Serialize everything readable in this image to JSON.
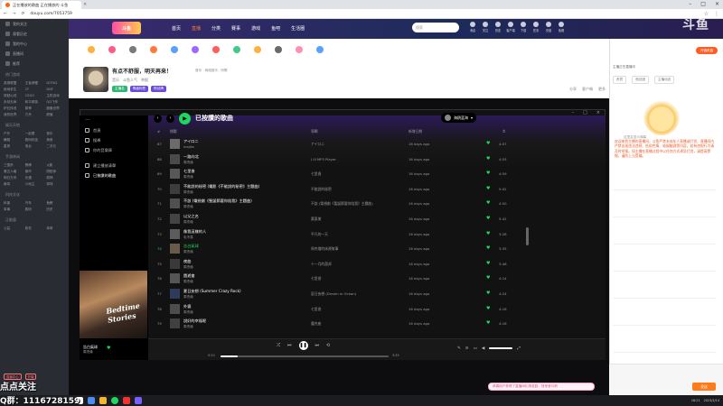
{
  "browser": {
    "tab_title": "正在播放的歌曲 正在播放的 斗鱼",
    "url": "douyu.com/7053759"
  },
  "douyu": {
    "logo_text": "斗鱼",
    "nav": [
      "首页",
      "直播",
      "分类",
      "赛事",
      "游戏",
      "鱼吧",
      "生活圈"
    ],
    "active_nav": 1,
    "search_placeholder": "搜索",
    "top_icons": [
      "消息",
      "关注",
      "历史",
      "客户端",
      "下载",
      "任务",
      "充值",
      "鱼翅"
    ],
    "sidebar": {
      "top_items": [
        "我的关注",
        "观看历史",
        "我的中心",
        "直播间",
        "推荐"
      ],
      "section1": "热门游戏",
      "games1": [
        "英雄联盟",
        "王者荣耀",
        "DOTA2",
        "绝地求生",
        "CF",
        "DNF",
        "穿越火线",
        "CSGO",
        "主机游戏",
        "永劫无间",
        "和平精英",
        "QQ飞车",
        "炉石传说",
        "原神",
        "魔兽世界",
        "我的世界",
        "方舟",
        "颜值"
      ],
      "section2": "娱乐天地",
      "games2": [
        "户外",
        "一起看",
        "音乐",
        "舞蹈",
        "数码科技",
        "美食",
        "星秀",
        "电台",
        "二次元"
      ],
      "section3": "手游休闲",
      "games3": [
        "三国杀",
        "棋牌",
        "火影",
        "第五人格",
        "崩坏",
        "阴阳师",
        "明日方舟",
        "光遇",
        "原神",
        "麻将",
        "斗地主",
        "球球"
      ],
      "section4": "科技文化",
      "games4": [
        "科普",
        "汽车",
        "鱼教",
        "军事",
        "数码",
        "历史"
      ],
      "section5": "正能量",
      "games5": [
        "公益",
        "政务",
        "体育"
      ],
      "bottom_btns": [
        "直播中心",
        "开播"
      ]
    }
  },
  "room": {
    "title": "有点不舒服，明天再来！",
    "meta": [
      "音乐",
      "斗鱼人气",
      "举报"
    ],
    "tags": [
      "主播名",
      "等级标签",
      "粉丝牌"
    ],
    "small_line": "音乐 · 网络音乐 · 听歌",
    "right_meta": [
      "分享",
      "客户端",
      "更多"
    ],
    "icon_strip_count": 12
  },
  "spotify": {
    "header_title": "已按讚的歌曲",
    "user": "海鸥蓝海",
    "sidebar_nav": [
      "首頁",
      "搜尋",
      "你的音樂庫"
    ],
    "sidebar_lib": [
      "建立播放清單",
      "已按讚的歌曲"
    ],
    "album_text": "Bedtime Stories",
    "now_playing_title": "告白氣球",
    "now_playing_artist": "周杰倫",
    "col_headers": {
      "num": "#",
      "title": "標題",
      "album": "專輯",
      "date": "新增日期",
      "dur": "⏱"
    },
    "rows": [
      {
        "n": "67",
        "t": "アイロニ",
        "a": "majiko",
        "al": "アイロニ",
        "d": "16 days ago",
        "du": "4:07"
      },
      {
        "n": "68",
        "t": "一路向北",
        "a": "周杰倫",
        "al": "J III MP3 Player",
        "d": "16 days ago",
        "du": "4:55"
      },
      {
        "n": "69",
        "t": "七里香",
        "a": "周杰倫",
        "al": "七里香",
        "d": "16 days ago",
        "du": "4:59"
      },
      {
        "n": "70",
        "t": "不能說的秘密 (電影《不能說的秘密》主題曲)",
        "a": "周杰倫",
        "al": "不能說的秘密",
        "d": "16 days ago",
        "du": "5:02"
      },
      {
        "n": "71",
        "t": "不該 (電視劇《聖誕節要你陪我》主題曲)",
        "a": "周杰倫",
        "al": "不該 (電視劇《聖誕節要你陪我》主題曲)",
        "d": "16 days ago",
        "du": "4:50"
      },
      {
        "n": "72",
        "t": "以父之名",
        "a": "周杰倫",
        "al": "葉惠美",
        "d": "16 days ago",
        "du": "5:42"
      },
      {
        "n": "73",
        "t": "像我這樣的人",
        "a": "毛不易",
        "al": "平凡的一天",
        "d": "16 days ago",
        "du": "3:28"
      },
      {
        "n": "74",
        "t": "告白氣球",
        "a": "周杰倫",
        "al": "周杰倫的床邊故事",
        "d": "16 days ago",
        "du": "3:35"
      },
      {
        "n": "75",
        "t": "夜曲",
        "a": "周杰倫",
        "al": "十一月的蕭邦",
        "d": "16 days ago",
        "du": "3:46"
      },
      {
        "n": "76",
        "t": "園遊會",
        "a": "周杰倫",
        "al": "七里香",
        "d": "16 days ago",
        "du": "4:14"
      },
      {
        "n": "77",
        "t": "夏日妄想 (Summer Crazy Rock)",
        "a": "周杰倫",
        "al": "夏日妄想 (Dream in Ocean)",
        "d": "16 days ago",
        "du": "4:24"
      },
      {
        "n": "78",
        "t": "外婆",
        "a": "周杰倫",
        "al": "七里香",
        "d": "16 days ago",
        "du": "4:16"
      },
      {
        "n": "79",
        "t": "說好的幸福呢",
        "a": "周杰倫",
        "al": "魔杰座",
        "d": "16 days ago",
        "du": "4:16"
      }
    ],
    "playing_index": 7,
    "time_elapsed": "0:20",
    "time_total": "3:35",
    "progress": 0.1
  },
  "chat": {
    "top_btn": "开通贵族",
    "tabs": [
      "贵宾",
      "粉丝团",
      "主播动态"
    ],
    "banner": "主播正在直播中",
    "hint": "这里会显示弹幕",
    "notice": "欢迎来到主播的直播间，斗鱼严禁未成年人直播或打赏，直播间内严禁出现违法违规、低俗色情、吸烟酗酒等内容，若有违规行为请及时举报。如主播在直播过程中以任何方式诱导打赏，请提高警惕，谨防上当受骗。",
    "send_label": "发送",
    "pill_text": "恭喜用户获得了直播间礼物奖励，快来参与吧"
  },
  "overlay": {
    "qq_line1": "点点关注",
    "qq_line2": "Q群：1116728159",
    "watermark": "斗鱼"
  },
  "tray": {
    "time": "16:21",
    "date": "2023/2/14"
  }
}
